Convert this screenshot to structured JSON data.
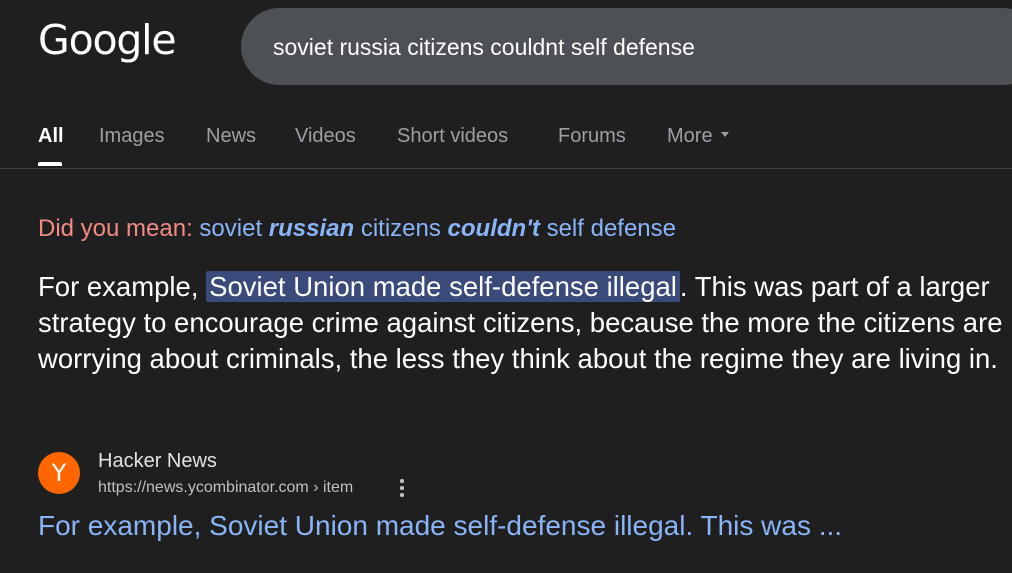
{
  "logo": {
    "text": "Google"
  },
  "search": {
    "query": "soviet russia citizens couldnt self defense"
  },
  "tabs": [
    {
      "label": "All"
    },
    {
      "label": "Images"
    },
    {
      "label": "News"
    },
    {
      "label": "Videos"
    },
    {
      "label": "Short videos"
    },
    {
      "label": "Forums"
    },
    {
      "label": "More"
    }
  ],
  "did_you_mean": {
    "label": "Did you mean:",
    "parts": [
      "soviet",
      "russian",
      "citizens",
      "couldn't",
      "self defense"
    ]
  },
  "snippet": {
    "before": "For example,",
    "highlight": "Soviet Union made self-defense illegal",
    "after": ". This was part of a larger strategy to encourage crime against citizens, because the more the citizens are worrying about criminals, the less they think about the regime they are living in."
  },
  "result": {
    "favicon_letter": "Y",
    "site_name": "Hacker News",
    "url": "https://news.ycombinator.com › item",
    "title": "For example, Soviet Union made self-defense illegal. This was ..."
  },
  "colors": {
    "background": "#1f1f1f",
    "search_box": "#4d5156",
    "link": "#8ab4f8",
    "did_you_mean_label": "#f28b82",
    "highlight": "#394a7b",
    "favicon": "#ff6600"
  }
}
